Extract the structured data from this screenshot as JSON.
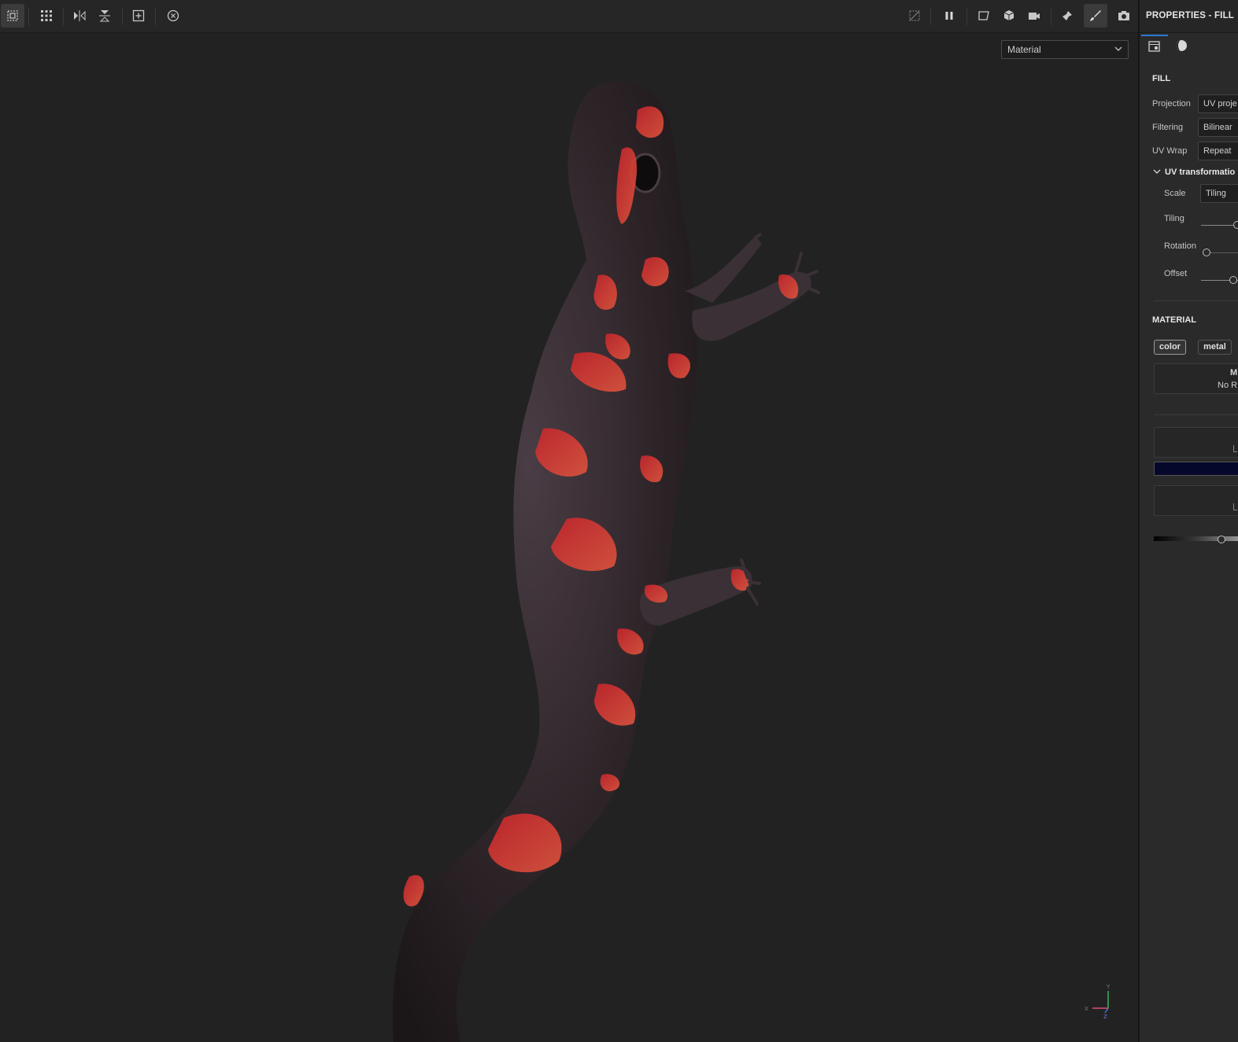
{
  "viewport": {
    "display_mode": {
      "selected": "Material"
    },
    "toolbar": {
      "left_tools": [
        "selection-icon",
        "grid-icon",
        "mirror-horizontal-icon",
        "mirror-vertical-icon",
        "add-frame-icon",
        "reset-camera-icon"
      ],
      "right_tools": [
        "hide-icon",
        "pause-icon",
        "viewport-frame-icon",
        "cube-icon",
        "camera-icon",
        "pin-icon",
        "paint-brush-icon",
        "screenshot-icon"
      ]
    },
    "axis_gizmo": {
      "x": "X",
      "y": "Y",
      "z": "Z"
    }
  },
  "panel": {
    "title": "PROPERTIES - FILL",
    "tabs": [
      "layer-settings-icon",
      "material-sphere-icon"
    ],
    "fill": {
      "heading": "FILL",
      "projection": {
        "label": "Projection",
        "value": "UV proje"
      },
      "filtering": {
        "label": "Filtering",
        "value": "Bilinear"
      },
      "uv_wrap": {
        "label": "UV Wrap",
        "value": "Repeat"
      }
    },
    "uv_transformation": {
      "heading": "UV transformatio",
      "scale": {
        "label": "Scale",
        "value": "Tiling"
      },
      "tiling": {
        "label": "Tiling"
      },
      "rotation": {
        "label": "Rotation"
      },
      "offset": {
        "label": "Offset"
      }
    },
    "material": {
      "heading": "MATERIAL",
      "chips": [
        "color",
        "metal"
      ],
      "box_line1": "M",
      "box_line2": "No R",
      "color_swatch": "#05082a",
      "accent": "#2d7ad6"
    }
  }
}
